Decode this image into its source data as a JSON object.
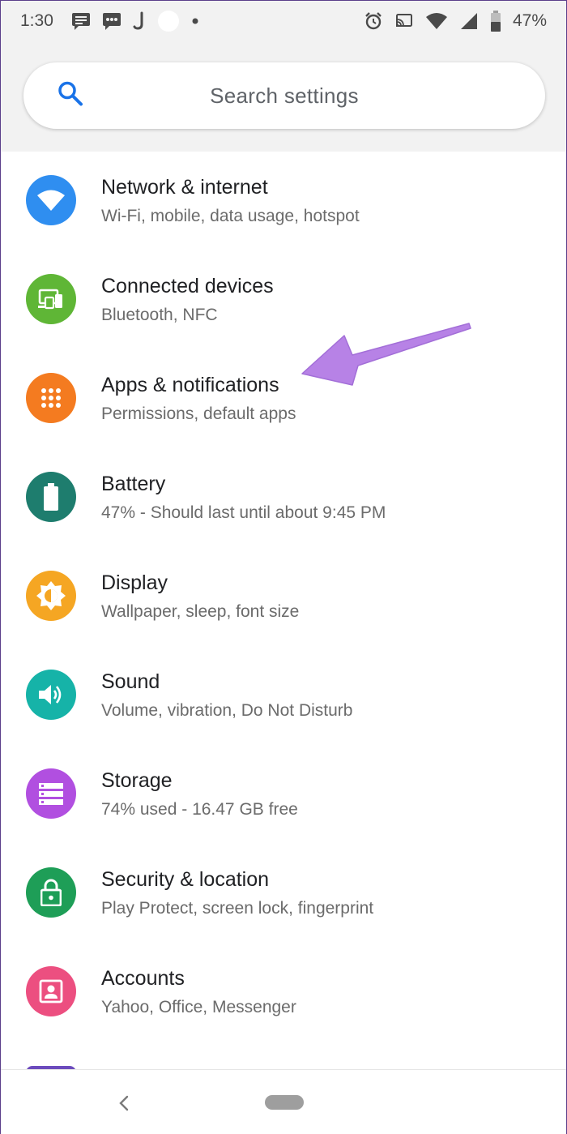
{
  "status_bar": {
    "time": "1:30",
    "battery_percent": "47%",
    "icons_left": [
      "message-icon",
      "chat-icon",
      "j-notification-icon",
      "circle-notification-icon",
      "dot-icon"
    ],
    "icons_right": [
      "alarm-icon",
      "cast-icon",
      "wifi-icon",
      "signal-icon",
      "battery-icon"
    ]
  },
  "search": {
    "placeholder": "Search settings"
  },
  "settings": [
    {
      "title": "Network & internet",
      "subtitle": "Wi-Fi, mobile, data usage, hotspot",
      "icon": "wifi-icon",
      "color": "#2f8ef0"
    },
    {
      "title": "Connected devices",
      "subtitle": "Bluetooth, NFC",
      "icon": "devices-icon",
      "color": "#5fb636"
    },
    {
      "title": "Apps & notifications",
      "subtitle": "Permissions, default apps",
      "icon": "apps-grid-icon",
      "color": "#f47b20"
    },
    {
      "title": "Battery",
      "subtitle": "47% - Should last until about 9:45 PM",
      "icon": "battery-icon",
      "color": "#1e7d6e"
    },
    {
      "title": "Display",
      "subtitle": "Wallpaper, sleep, font size",
      "icon": "brightness-icon",
      "color": "#f5a623"
    },
    {
      "title": "Sound",
      "subtitle": "Volume, vibration, Do Not Disturb",
      "icon": "volume-icon",
      "color": "#16b3a8"
    },
    {
      "title": "Storage",
      "subtitle": "74% used - 16.47 GB free",
      "icon": "storage-icon",
      "color": "#b14fe0"
    },
    {
      "title": "Security & location",
      "subtitle": "Play Protect, screen lock, fingerprint",
      "icon": "lock-icon",
      "color": "#1e9e57"
    },
    {
      "title": "Accounts",
      "subtitle": "Yahoo, Office, Messenger",
      "icon": "account-icon",
      "color": "#ec4f80"
    }
  ],
  "annotation": {
    "color": "#b782e6",
    "icon": "arrow-annotation-icon"
  },
  "colors": {
    "status_bar_bg": "#f2f2f2",
    "search_icon": "#1a73e8"
  }
}
